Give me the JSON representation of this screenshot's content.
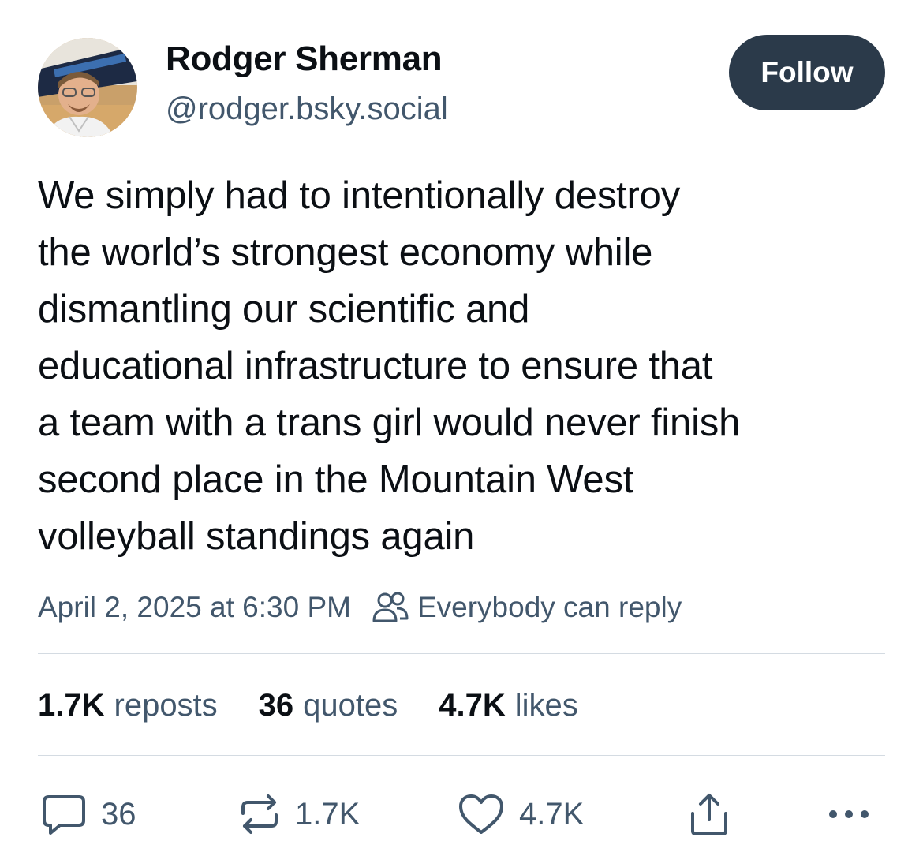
{
  "author": {
    "name": "Rodger Sherman",
    "handle": "@rodger.bsky.social",
    "avatar_icon": "profile-photo"
  },
  "follow_label": "Follow",
  "post": {
    "text": "We simply had to intentionally destroy\nthe world’s strongest economy while\ndismantling our scientific and\neducational infrastructure to ensure that\na team with a trans girl would never finish\nsecond place in the Mountain West\nvolleyball standings again",
    "timestamp": "April 2, 2025 at 6:30 PM",
    "reply_setting": "Everybody can reply"
  },
  "stats": {
    "reposts": {
      "value": "1.7K",
      "label": "reposts"
    },
    "quotes": {
      "value": "36",
      "label": "quotes"
    },
    "likes": {
      "value": "4.7K",
      "label": "likes"
    }
  },
  "actions": {
    "reply_count": "36",
    "repost_count": "1.7K",
    "like_count": "4.7K",
    "icons": [
      "reply-icon",
      "repost-icon",
      "like-icon",
      "share-icon",
      "more-icon"
    ]
  },
  "colors": {
    "text": "#0b0f14",
    "muted": "#42576c",
    "follow_bg": "#2b3a4a",
    "divider": "#d4dbe2"
  }
}
